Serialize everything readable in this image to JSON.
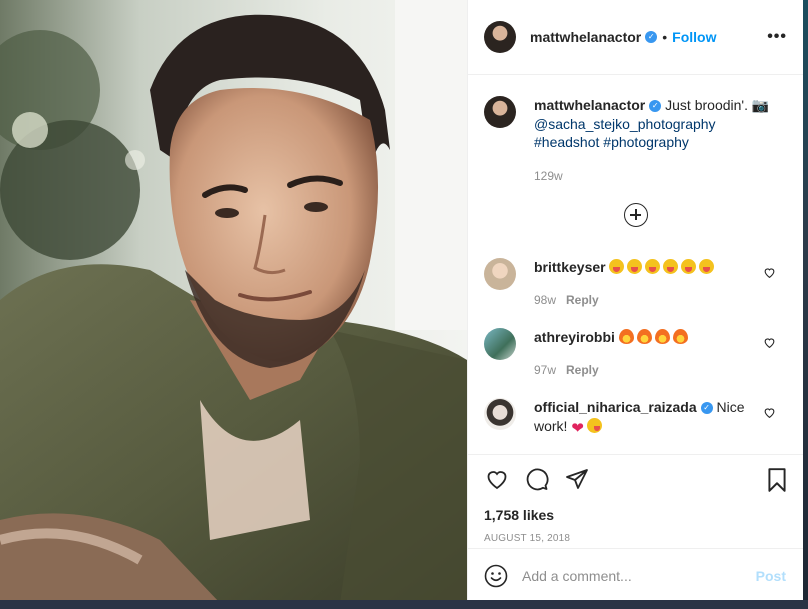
{
  "post": {
    "author": "mattwhelanactor",
    "follow_label": "Follow",
    "separator": "•",
    "more_label": "•••"
  },
  "caption": {
    "username": "mattwhelanactor",
    "text": "Just broodin'.",
    "camera_emoji": "📷",
    "mention": "@sacha_stejko_photography",
    "hashtags": "#headshot #photography",
    "age": "129w"
  },
  "comments": [
    {
      "username": "brittkeyser",
      "text": "",
      "emoji": [
        "tongue",
        "tongue",
        "tongue",
        "tongue",
        "tongue",
        "tongue"
      ],
      "age": "98w",
      "reply_label": "Reply",
      "avatar_color": "#c9b49a"
    },
    {
      "username": "athreyirobbi",
      "text": "",
      "emoji": [
        "fire",
        "fire",
        "fire",
        "fire"
      ],
      "age": "97w",
      "reply_label": "Reply",
      "avatar_color": "#6aa5b5"
    },
    {
      "username": "official_niharica_raizada",
      "text_before": "Nice",
      "text_after": "work!",
      "emoji": [
        "red-heart",
        "wink"
      ],
      "avatar_color": "#d8d0c8"
    }
  ],
  "actions": {
    "likes": "1,758 likes",
    "date": "AUGUST 15, 2018"
  },
  "add_comment": {
    "placeholder": "Add a comment...",
    "post_label": "Post"
  },
  "icons": {
    "more": "more-options-icon",
    "like": "heart-icon",
    "comment": "comment-icon",
    "share": "share-icon",
    "save": "bookmark-icon",
    "emoji": "emoji-icon",
    "load_more": "plus-circle-icon",
    "verified": "verified-badge-icon"
  },
  "colors": {
    "accent": "#0095f6",
    "text": "#262626",
    "muted": "#8e8e8e",
    "link": "#00376b",
    "post_disabled": "#b2dffc"
  }
}
